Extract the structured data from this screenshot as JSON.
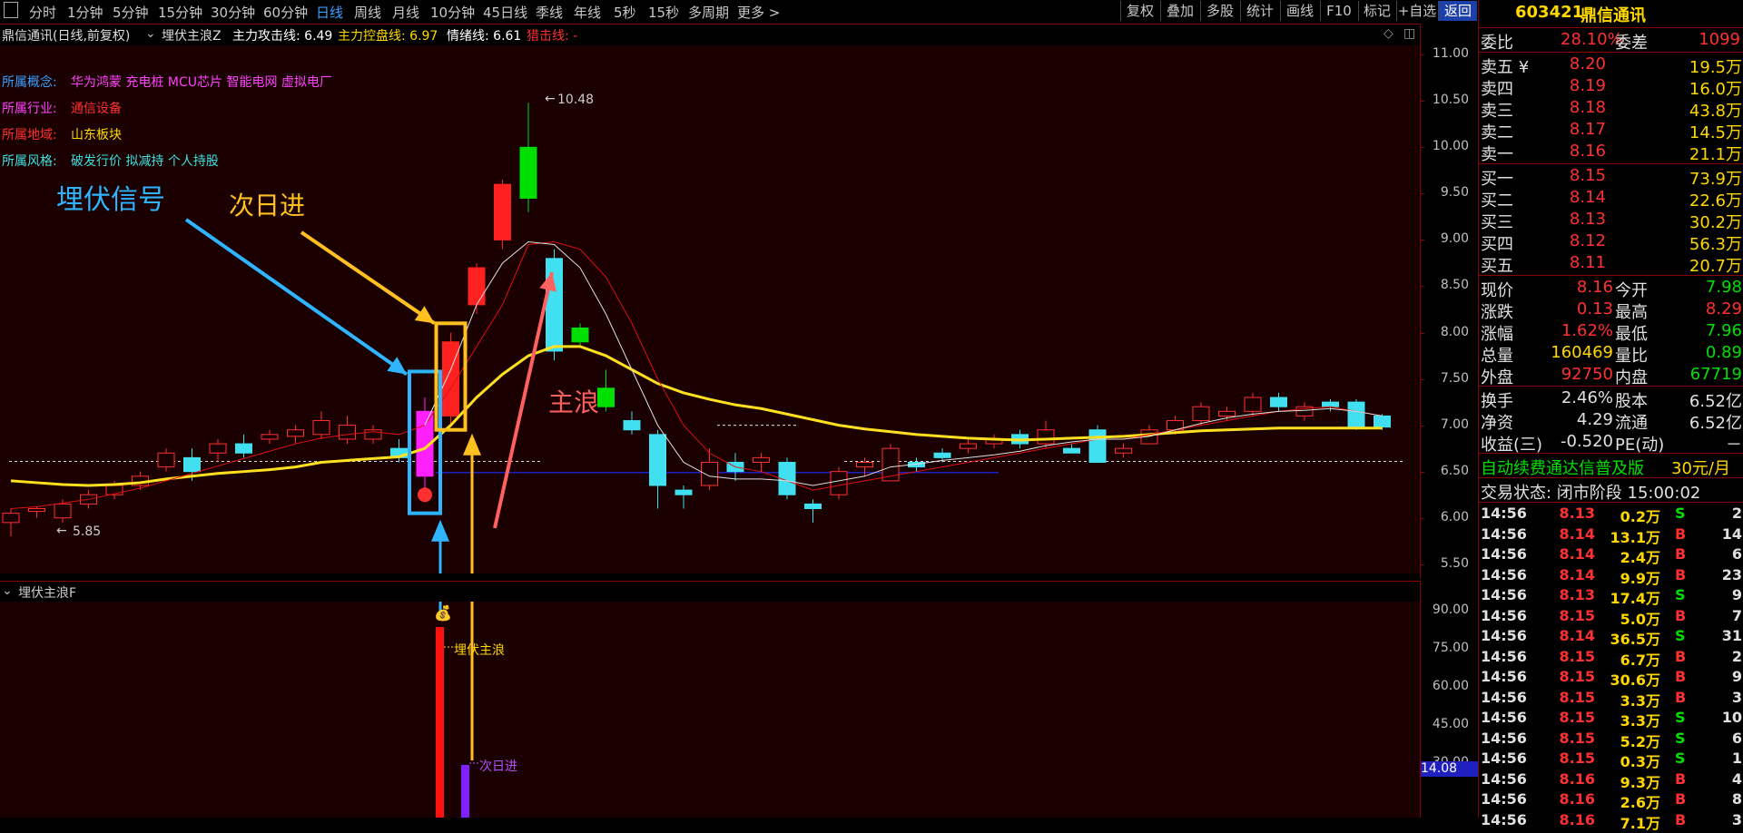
{
  "toolbar": {
    "menu_icon": "menu-icon",
    "periods": [
      "分时",
      "1分钟",
      "5分钟",
      "15分钟",
      "30分钟",
      "60分钟",
      "日线",
      "周线",
      "月线",
      "10分钟",
      "45日线",
      "季线",
      "年线",
      "5秒",
      "15秒",
      "多周期",
      "更多 >"
    ],
    "active_period": "日线",
    "right_buttons": [
      "复权",
      "叠加",
      "多股",
      "统计",
      "画线",
      "F10",
      "标记",
      "+自选",
      "返回"
    ]
  },
  "info_bar": {
    "stock_title": "鼎信通讯(日线,前复权)",
    "indicator_name": "埋伏主浪Z",
    "attack_label": "主力攻击线: 6.49",
    "control_label": "主力控盘线: 6.97",
    "sentiment_label": "情绪线: 6.61",
    "strike_label": "猎击线: -"
  },
  "stock_info": {
    "concept_label": "所属概念:",
    "concept_value": "华为鸿蒙 充电桩 MCU芯片 智能电网 虚拟电厂",
    "industry_label": "所属行业:",
    "industry_value": "通信设备",
    "region_label": "所属地域:",
    "region_value": "山东板块",
    "style_label": "所属风格:",
    "style_value": "破发行价 拟减持 个人持股"
  },
  "annotations": {
    "signal": "埋伏信号",
    "next_day": "次日进",
    "main_wave": "主浪",
    "high_mark": "10.48",
    "low_mark": "5.85",
    "sub_main_wave": "埋伏主浪",
    "sub_next_day": "次日进"
  },
  "main_axis_ticks": [
    "11.00",
    "10.50",
    "10.00",
    "9.50",
    "9.00",
    "8.50",
    "8.00",
    "7.50",
    "7.00",
    "6.50",
    "6.00",
    "5.50"
  ],
  "sub_header": {
    "indicator": "埋伏主浪F"
  },
  "sub_axis_ticks": [
    "90.00",
    "75.00",
    "60.00",
    "45.00",
    "30.00"
  ],
  "sub_axis_marker": "14.08",
  "chart_data": {
    "type": "candlestick",
    "ylim": [
      5.4,
      11.1
    ],
    "candles": [
      [
        5.95,
        6.05,
        5.8,
        6.1
      ],
      [
        6.07,
        6.1,
        6.0,
        6.12
      ],
      [
        6.0,
        6.15,
        5.95,
        6.2
      ],
      [
        6.15,
        6.25,
        6.1,
        6.3
      ],
      [
        6.25,
        6.35,
        6.2,
        6.4
      ],
      [
        6.35,
        6.45,
        6.3,
        6.5
      ],
      [
        6.55,
        6.7,
        6.5,
        6.75
      ],
      [
        6.65,
        6.5,
        6.4,
        6.75
      ],
      [
        6.7,
        6.8,
        6.6,
        6.85
      ],
      [
        6.8,
        6.7,
        6.65,
        6.9
      ],
      [
        6.85,
        6.9,
        6.8,
        6.95
      ],
      [
        6.88,
        6.95,
        6.8,
        7.0
      ],
      [
        6.9,
        7.05,
        6.85,
        7.15
      ],
      [
        6.85,
        7.0,
        6.8,
        7.1
      ],
      [
        6.85,
        6.95,
        6.8,
        7.0
      ],
      [
        6.75,
        6.65,
        6.6,
        6.85
      ],
      [
        6.45,
        7.15,
        6.3,
        7.3
      ],
      [
        7.1,
        7.9,
        7.0,
        8.0
      ],
      [
        8.3,
        8.7,
        8.2,
        8.75
      ],
      [
        9.0,
        9.6,
        8.9,
        9.65
      ],
      [
        10.0,
        9.45,
        9.3,
        10.48
      ],
      [
        8.8,
        7.8,
        7.7,
        8.9
      ],
      [
        8.05,
        7.9,
        7.85,
        8.1
      ],
      [
        7.4,
        7.2,
        7.15,
        7.6
      ],
      [
        7.05,
        6.95,
        6.9,
        7.15
      ],
      [
        6.9,
        6.35,
        6.1,
        6.95
      ],
      [
        6.3,
        6.25,
        6.1,
        6.35
      ],
      [
        6.35,
        6.6,
        6.3,
        6.75
      ],
      [
        6.6,
        6.5,
        6.4,
        6.7
      ],
      [
        6.6,
        6.65,
        6.5,
        6.7
      ],
      [
        6.6,
        6.25,
        6.2,
        6.65
      ],
      [
        6.15,
        6.1,
        5.95,
        6.2
      ],
      [
        6.25,
        6.5,
        6.2,
        6.55
      ],
      [
        6.55,
        6.6,
        6.45,
        6.65
      ],
      [
        6.4,
        6.75,
        6.4,
        6.8
      ],
      [
        6.6,
        6.55,
        6.5,
        6.65
      ],
      [
        6.7,
        6.65,
        6.6,
        6.75
      ],
      [
        6.75,
        6.8,
        6.7,
        6.85
      ],
      [
        6.8,
        6.85,
        6.75,
        6.9
      ],
      [
        6.9,
        6.8,
        6.75,
        6.95
      ],
      [
        6.8,
        6.95,
        6.75,
        7.05
      ],
      [
        6.75,
        6.7,
        6.7,
        6.8
      ],
      [
        6.95,
        6.6,
        6.6,
        7.0
      ],
      [
        6.7,
        6.75,
        6.65,
        6.8
      ],
      [
        6.8,
        6.95,
        6.8,
        7.0
      ],
      [
        6.95,
        7.05,
        6.9,
        7.1
      ],
      [
        7.05,
        7.2,
        7.0,
        7.25
      ],
      [
        7.1,
        7.15,
        7.05,
        7.2
      ],
      [
        7.15,
        7.3,
        7.1,
        7.35
      ],
      [
        7.3,
        7.2,
        7.15,
        7.35
      ],
      [
        7.1,
        7.2,
        7.05,
        7.25
      ],
      [
        7.25,
        7.2,
        7.15,
        7.28
      ],
      [
        7.25,
        6.98,
        6.95,
        7.28
      ],
      [
        7.1,
        6.98,
        6.95,
        7.12
      ]
    ],
    "yellow_ma": [
      6.4,
      6.38,
      6.36,
      6.35,
      6.36,
      6.38,
      6.42,
      6.45,
      6.48,
      6.5,
      6.52,
      6.55,
      6.6,
      6.62,
      6.64,
      6.66,
      6.75,
      7.0,
      7.3,
      7.55,
      7.75,
      7.85,
      7.85,
      7.75,
      7.6,
      7.45,
      7.35,
      7.28,
      7.22,
      7.18,
      7.12,
      7.06,
      7.0,
      6.96,
      6.93,
      6.9,
      6.88,
      6.86,
      6.85,
      6.84,
      6.85,
      6.86,
      6.87,
      6.88,
      6.9,
      6.92,
      6.94,
      6.95,
      6.96,
      6.97,
      6.97,
      6.97,
      6.97,
      6.97
    ],
    "white_ma": [
      null,
      null,
      null,
      null,
      null,
      null,
      null,
      null,
      null,
      null,
      null,
      null,
      null,
      null,
      null,
      null,
      7.0,
      7.6,
      8.3,
      8.75,
      8.98,
      8.95,
      8.7,
      8.2,
      7.6,
      7.0,
      6.6,
      6.45,
      6.42,
      6.42,
      6.4,
      6.35,
      6.4,
      6.45,
      6.55,
      6.58,
      6.62,
      6.65,
      6.68,
      6.72,
      6.78,
      6.82,
      6.85,
      6.85,
      6.88,
      6.95,
      7.02,
      7.08,
      7.12,
      7.15,
      7.16,
      7.18,
      7.15,
      7.1
    ],
    "red_ma": [
      6.1,
      6.12,
      6.16,
      6.2,
      6.26,
      6.32,
      6.4,
      6.48,
      6.56,
      6.64,
      6.72,
      6.8,
      6.86,
      6.9,
      6.93,
      6.9,
      7.0,
      7.4,
      7.85,
      8.3,
      8.95,
      8.98,
      8.9,
      8.6,
      8.1,
      7.5,
      7.0,
      6.7,
      6.55,
      6.5,
      6.4,
      6.3,
      6.35,
      6.4,
      6.45,
      6.5,
      6.55,
      6.6,
      6.65,
      6.7,
      6.75,
      6.8,
      6.85,
      6.85,
      6.9,
      6.95,
      7.0,
      7.05,
      7.1,
      7.15,
      7.18,
      7.2,
      7.15,
      7.1
    ],
    "dotted_level": 6.61,
    "base_level": 6.49
  },
  "panel": {
    "code": "603421",
    "name": "鼎信通讯",
    "webi_label": "委比",
    "webi_value": "28.10%",
    "weicha_label": "委差",
    "weicha_value": "1099",
    "sells": [
      {
        "label": "卖五 ¥",
        "price": "8.20",
        "vol": "19.5万"
      },
      {
        "label": "卖四",
        "price": "8.19",
        "vol": "16.0万"
      },
      {
        "label": "卖三",
        "price": "8.18",
        "vol": "43.8万"
      },
      {
        "label": "卖二",
        "price": "8.17",
        "vol": "14.5万"
      },
      {
        "label": "卖一",
        "price": "8.16",
        "vol": "21.1万"
      }
    ],
    "buys": [
      {
        "label": "买一",
        "price": "8.15",
        "vol": "73.9万"
      },
      {
        "label": "买二",
        "price": "8.14",
        "vol": "22.6万"
      },
      {
        "label": "买三",
        "price": "8.13",
        "vol": "30.2万"
      },
      {
        "label": "买四",
        "price": "8.12",
        "vol": "56.3万"
      },
      {
        "label": "买五",
        "price": "8.11",
        "vol": "20.7万"
      }
    ],
    "stats": [
      {
        "l1": "现价",
        "v1": "8.16",
        "c1": "red",
        "l2": "今开",
        "v2": "7.98",
        "c2": "green"
      },
      {
        "l1": "涨跌",
        "v1": "0.13",
        "c1": "red",
        "l2": "最高",
        "v2": "8.29",
        "c2": "red"
      },
      {
        "l1": "涨幅",
        "v1": "1.62%",
        "c1": "red",
        "l2": "最低",
        "v2": "7.96",
        "c2": "green"
      },
      {
        "l1": "总量",
        "v1": "160469",
        "c1": "yellow",
        "l2": "量比",
        "v2": "0.89",
        "c2": "green"
      },
      {
        "l1": "外盘",
        "v1": "92750",
        "c1": "red",
        "l2": "内盘",
        "v2": "67719",
        "c2": "green"
      }
    ],
    "stats2": [
      {
        "l1": "换手",
        "v1": "2.46%",
        "l2": "股本",
        "v2": "6.52亿"
      },
      {
        "l1": "净资",
        "v1": "4.29",
        "l2": "流通",
        "v2": "6.52亿"
      },
      {
        "l1": "收益(三)",
        "v1": "-0.520",
        "l2": "PE(动)",
        "v2": "－"
      }
    ],
    "ad_text": "自动续费通达信普及版",
    "ad_price": "30元/月",
    "trade_status": "交易状态: 闭市阶段 15:00:02",
    "ticks": [
      {
        "t": "14:56",
        "p": "8.13",
        "v": "0.2万",
        "d": "S",
        "n": "2"
      },
      {
        "t": "14:56",
        "p": "8.14",
        "v": "13.1万",
        "d": "B",
        "n": "14"
      },
      {
        "t": "14:56",
        "p": "8.14",
        "v": "2.4万",
        "d": "B",
        "n": "6"
      },
      {
        "t": "14:56",
        "p": "8.14",
        "v": "9.9万",
        "d": "B",
        "n": "23"
      },
      {
        "t": "14:56",
        "p": "8.13",
        "v": "17.4万",
        "d": "S",
        "n": "9"
      },
      {
        "t": "14:56",
        "p": "8.15",
        "v": "5.0万",
        "d": "B",
        "n": "7"
      },
      {
        "t": "14:56",
        "p": "8.14",
        "v": "36.5万",
        "d": "S",
        "n": "31"
      },
      {
        "t": "14:56",
        "p": "8.15",
        "v": "6.7万",
        "d": "B",
        "n": "2"
      },
      {
        "t": "14:56",
        "p": "8.15",
        "v": "30.6万",
        "d": "B",
        "n": "9"
      },
      {
        "t": "14:56",
        "p": "8.15",
        "v": "3.3万",
        "d": "B",
        "n": "3"
      },
      {
        "t": "14:56",
        "p": "8.15",
        "v": "3.3万",
        "d": "S",
        "n": "10"
      },
      {
        "t": "14:56",
        "p": "8.15",
        "v": "5.2万",
        "d": "S",
        "n": "6"
      },
      {
        "t": "14:56",
        "p": "8.15",
        "v": "0.3万",
        "d": "S",
        "n": "1"
      },
      {
        "t": "14:56",
        "p": "8.16",
        "v": "9.3万",
        "d": "B",
        "n": "4"
      },
      {
        "t": "14:56",
        "p": "8.16",
        "v": "2.6万",
        "d": "B",
        "n": "8"
      },
      {
        "t": "14:56",
        "p": "8.16",
        "v": "7.1万",
        "d": "B",
        "n": "3"
      }
    ]
  }
}
